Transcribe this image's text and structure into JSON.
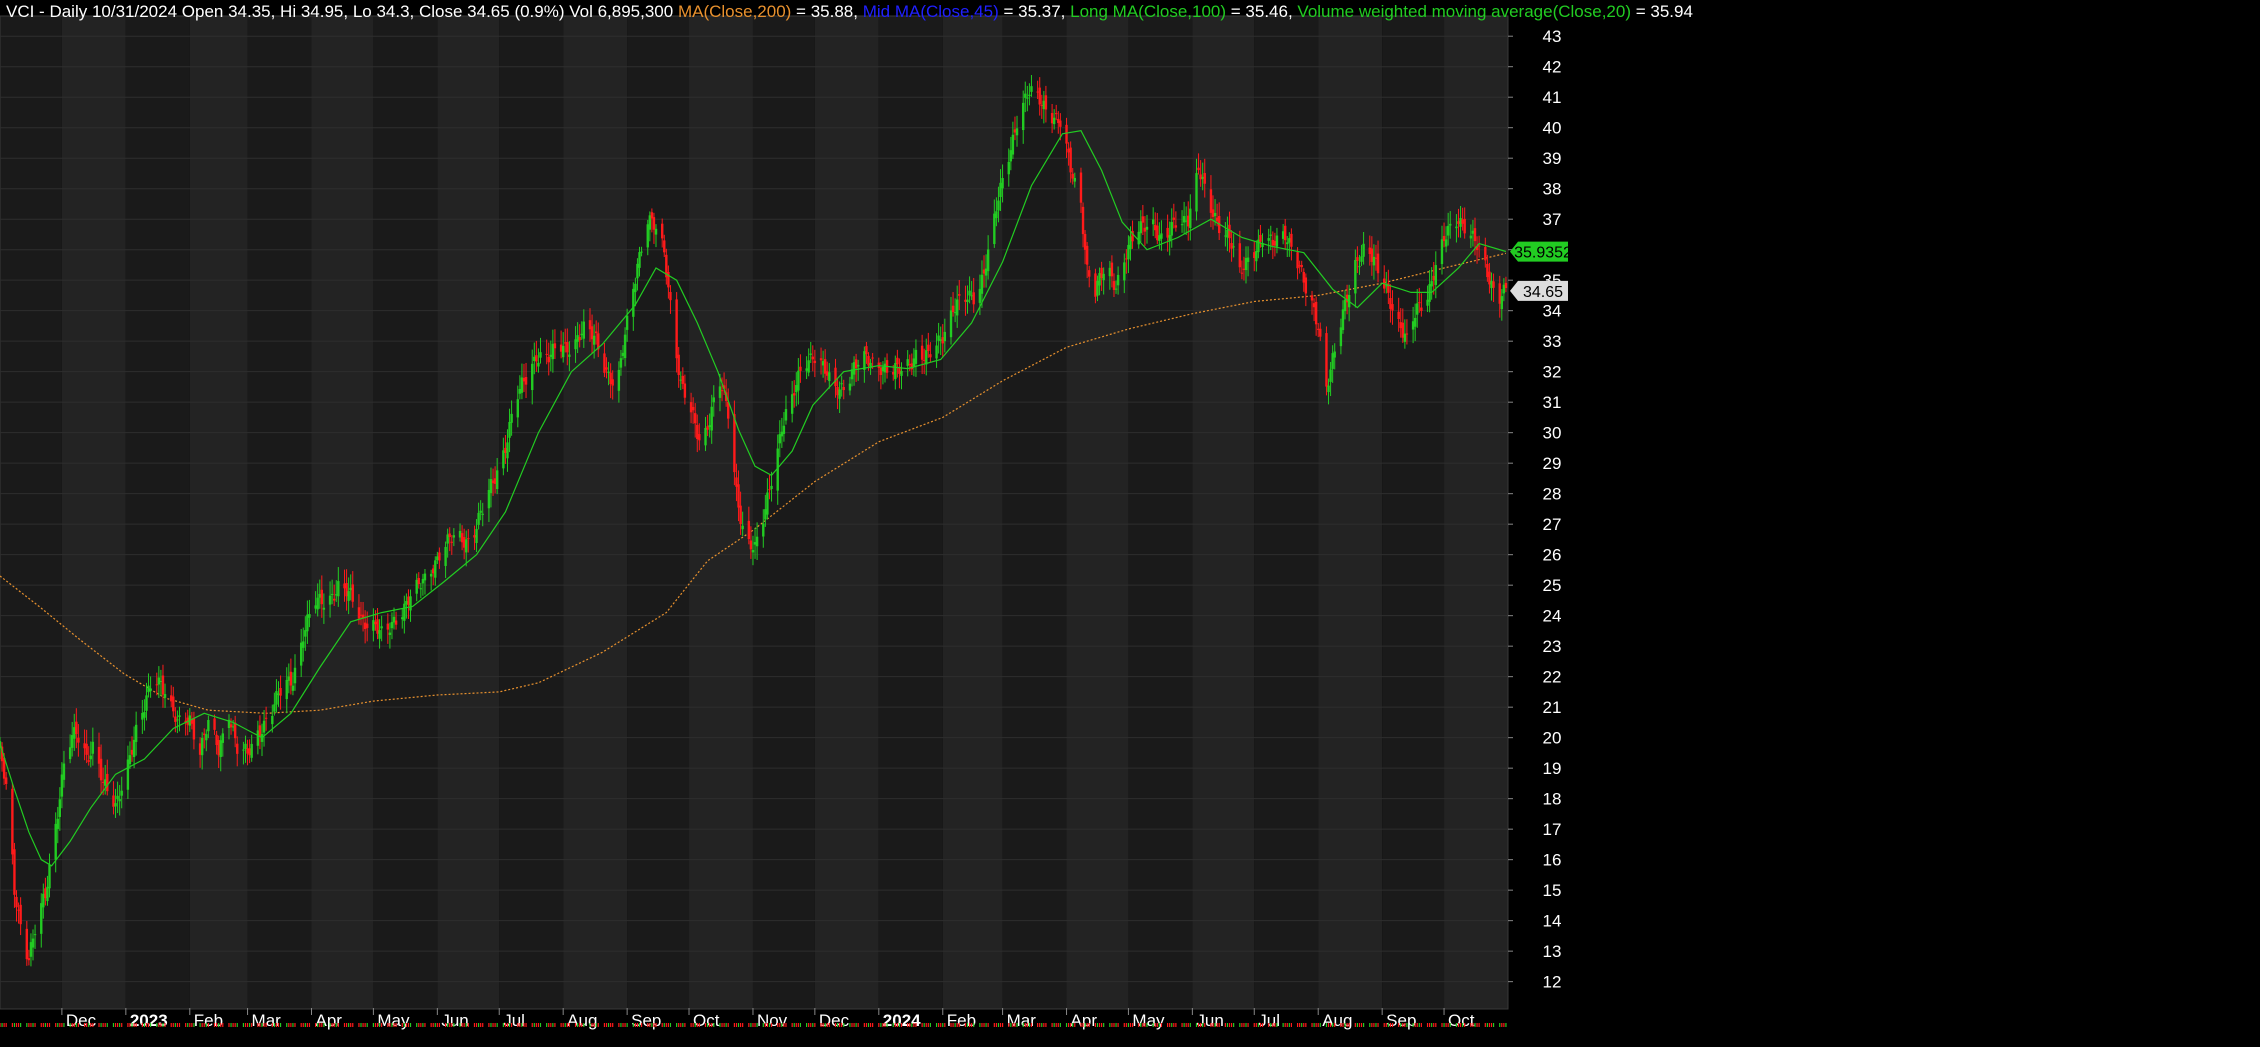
{
  "header": {
    "quote": "VCI - Daily 10/31/2024 Open 34.35, Hi 34.95, Lo 34.3, Close 34.65 (0.9%) Vol 6,895,300 ",
    "ma200_label": "MA(Close,200)",
    "ma200_value": " = 35.88, ",
    "mid_ma_label": "Mid MA(Close,45)",
    "mid_ma_value": " = 35.37, ",
    "long_ma_label": "Long MA(Close,100)",
    "long_ma_value": " = 35.46, ",
    "vwma_label": "Volume weighted moving average(Close,20)",
    "vwma_value": " = 35.94"
  },
  "colors": {
    "background": "#000000",
    "plot_band_a": "#1a1a1a",
    "plot_band_b": "#232323",
    "grid": "#2e2e2e",
    "up_candle": "#22cc22",
    "down_candle": "#ff1a1a",
    "vwma_line": "#22cc22",
    "ma200_line": "#e8912e",
    "mid_ma_label": "#2020ff",
    "axis_text": "#ffffff",
    "vwma_badge": "#22cc22",
    "price_badge": "#dddddd"
  },
  "chart_data": {
    "type": "candlestick",
    "symbol": "VCI",
    "y_axis": {
      "min": 11.3,
      "max": 43.4,
      "ticks": [
        12,
        13,
        14,
        15,
        16,
        17,
        18,
        19,
        20,
        21,
        22,
        23,
        24,
        25,
        26,
        27,
        28,
        29,
        30,
        31,
        32,
        33,
        34,
        35,
        36,
        37,
        38,
        39,
        40,
        41,
        42,
        43
      ]
    },
    "x_axis": {
      "start": "2022-11-01",
      "end": "2024-10-31",
      "right_margin_days": 1,
      "month_labels": [
        {
          "date": "2022-12-01",
          "label": "Dec",
          "bold": false
        },
        {
          "date": "2023-01-01",
          "label": "2023",
          "bold": true
        },
        {
          "date": "2023-02-01",
          "label": "Feb",
          "bold": false
        },
        {
          "date": "2023-03-01",
          "label": "Mar",
          "bold": false
        },
        {
          "date": "2023-04-01",
          "label": "Apr",
          "bold": false
        },
        {
          "date": "2023-05-01",
          "label": "May",
          "bold": false
        },
        {
          "date": "2023-06-01",
          "label": "Jun",
          "bold": false
        },
        {
          "date": "2023-07-01",
          "label": "Jul",
          "bold": false
        },
        {
          "date": "2023-08-01",
          "label": "Aug",
          "bold": false
        },
        {
          "date": "2023-09-01",
          "label": "Sep",
          "bold": false
        },
        {
          "date": "2023-10-01",
          "label": "Oct",
          "bold": false
        },
        {
          "date": "2023-11-01",
          "label": "Nov",
          "bold": false
        },
        {
          "date": "2023-12-01",
          "label": "Dec",
          "bold": false
        },
        {
          "date": "2024-01-01",
          "label": "2024",
          "bold": true
        },
        {
          "date": "2024-02-01",
          "label": "Feb",
          "bold": false
        },
        {
          "date": "2024-03-01",
          "label": "Mar",
          "bold": false
        },
        {
          "date": "2024-04-01",
          "label": "Apr",
          "bold": false
        },
        {
          "date": "2024-05-01",
          "label": "May",
          "bold": false
        },
        {
          "date": "2024-06-01",
          "label": "Jun",
          "bold": false
        },
        {
          "date": "2024-07-01",
          "label": "Jul",
          "bold": false
        },
        {
          "date": "2024-08-01",
          "label": "Aug",
          "bold": false
        },
        {
          "date": "2024-09-01",
          "label": "Sep",
          "bold": false
        },
        {
          "date": "2024-10-01",
          "label": "Oct",
          "bold": false
        }
      ]
    },
    "close_path": [
      [
        "2022-11-01",
        19.6
      ],
      [
        "2022-11-05",
        17.8
      ],
      [
        "2022-11-08",
        15.0
      ],
      [
        "2022-11-12",
        13.6
      ],
      [
        "2022-11-15",
        12.8
      ],
      [
        "2022-11-19",
        13.9
      ],
      [
        "2022-11-23",
        14.8
      ],
      [
        "2022-11-28",
        17.2
      ],
      [
        "2022-12-03",
        19.6
      ],
      [
        "2022-12-08",
        20.1
      ],
      [
        "2022-12-13",
        19.4
      ],
      [
        "2022-12-17",
        19.9
      ],
      [
        "2022-12-21",
        18.4
      ],
      [
        "2022-12-27",
        17.7
      ],
      [
        "2022-12-31",
        18.8
      ],
      [
        "2023-01-05",
        19.9
      ],
      [
        "2023-01-10",
        20.9
      ],
      [
        "2023-01-14",
        22.1
      ],
      [
        "2023-01-18",
        21.9
      ],
      [
        "2023-01-22",
        21.1
      ],
      [
        "2023-01-26",
        20.4
      ],
      [
        "2023-02-01",
        20.7
      ],
      [
        "2023-02-06",
        19.6
      ],
      [
        "2023-02-10",
        20.4
      ],
      [
        "2023-02-15",
        19.6
      ],
      [
        "2023-02-20",
        20.9
      ],
      [
        "2023-02-24",
        19.6
      ],
      [
        "2023-03-01",
        19.4
      ],
      [
        "2023-03-07",
        20.3
      ],
      [
        "2023-03-13",
        20.9
      ],
      [
        "2023-03-18",
        21.6
      ],
      [
        "2023-03-23",
        22.0
      ],
      [
        "2023-03-28",
        23.4
      ],
      [
        "2023-04-03",
        24.4
      ],
      [
        "2023-04-09",
        24.6
      ],
      [
        "2023-04-14",
        24.9
      ],
      [
        "2023-04-20",
        24.6
      ],
      [
        "2023-04-26",
        23.9
      ],
      [
        "2023-05-01",
        23.7
      ],
      [
        "2023-05-06",
        23.2
      ],
      [
        "2023-05-11",
        23.9
      ],
      [
        "2023-05-17",
        24.4
      ],
      [
        "2023-05-23",
        24.9
      ],
      [
        "2023-05-29",
        25.6
      ],
      [
        "2023-06-04",
        26.2
      ],
      [
        "2023-06-10",
        26.6
      ],
      [
        "2023-06-17",
        26.5
      ],
      [
        "2023-06-23",
        27.4
      ],
      [
        "2023-06-29",
        28.6
      ],
      [
        "2023-07-04",
        29.6
      ],
      [
        "2023-07-09",
        31.0
      ],
      [
        "2023-07-14",
        31.8
      ],
      [
        "2023-07-19",
        32.6
      ],
      [
        "2023-07-25",
        32.4
      ],
      [
        "2023-07-30",
        32.8
      ],
      [
        "2023-08-05",
        32.9
      ],
      [
        "2023-08-11",
        33.3
      ],
      [
        "2023-08-17",
        33.1
      ],
      [
        "2023-08-22",
        32.1
      ],
      [
        "2023-08-27",
        31.3
      ],
      [
        "2023-09-01",
        33.6
      ],
      [
        "2023-09-06",
        35.6
      ],
      [
        "2023-09-11",
        37.0
      ],
      [
        "2023-09-15",
        36.6
      ],
      [
        "2023-09-19",
        35.9
      ],
      [
        "2023-09-22",
        34.3
      ],
      [
        "2023-09-27",
        31.6
      ],
      [
        "2023-10-02",
        30.6
      ],
      [
        "2023-10-07",
        29.6
      ],
      [
        "2023-10-12",
        30.8
      ],
      [
        "2023-10-16",
        31.6
      ],
      [
        "2023-10-20",
        30.6
      ],
      [
        "2023-10-24",
        28.1
      ],
      [
        "2023-10-28",
        26.6
      ],
      [
        "2023-11-02",
        26.1
      ],
      [
        "2023-11-06",
        27.1
      ],
      [
        "2023-11-10",
        28.6
      ],
      [
        "2023-11-15",
        30.2
      ],
      [
        "2023-11-20",
        31.0
      ],
      [
        "2023-11-25",
        32.3
      ],
      [
        "2023-11-30",
        32.6
      ],
      [
        "2023-12-05",
        32.1
      ],
      [
        "2023-12-10",
        31.4
      ],
      [
        "2023-12-15",
        31.6
      ],
      [
        "2023-12-20",
        32.1
      ],
      [
        "2023-12-26",
        32.4
      ],
      [
        "2024-01-01",
        32.3
      ],
      [
        "2024-01-07",
        31.9
      ],
      [
        "2024-01-13",
        32.1
      ],
      [
        "2024-01-19",
        32.6
      ],
      [
        "2024-01-25",
        32.4
      ],
      [
        "2024-01-31",
        33.1
      ],
      [
        "2024-02-06",
        34.1
      ],
      [
        "2024-02-12",
        34.3
      ],
      [
        "2024-02-18",
        34.6
      ],
      [
        "2024-02-23",
        35.9
      ],
      [
        "2024-02-28",
        37.6
      ],
      [
        "2024-03-04",
        39.1
      ],
      [
        "2024-03-09",
        40.6
      ],
      [
        "2024-03-14",
        41.1
      ],
      [
        "2024-03-19",
        40.9
      ],
      [
        "2024-03-24",
        40.6
      ],
      [
        "2024-03-29",
        40.1
      ],
      [
        "2024-04-03",
        38.6
      ],
      [
        "2024-04-08",
        37.6
      ],
      [
        "2024-04-11",
        35.4
      ],
      [
        "2024-04-15",
        34.6
      ],
      [
        "2024-04-20",
        35.4
      ],
      [
        "2024-04-25",
        34.9
      ],
      [
        "2024-04-30",
        35.9
      ],
      [
        "2024-05-06",
        36.6
      ],
      [
        "2024-05-12",
        37.1
      ],
      [
        "2024-05-18",
        36.1
      ],
      [
        "2024-05-24",
        36.9
      ],
      [
        "2024-05-30",
        37.1
      ],
      [
        "2024-06-04",
        38.6
      ],
      [
        "2024-06-09",
        37.4
      ],
      [
        "2024-06-14",
        36.9
      ],
      [
        "2024-06-19",
        36.4
      ],
      [
        "2024-06-24",
        35.1
      ],
      [
        "2024-06-29",
        35.9
      ],
      [
        "2024-07-05",
        36.4
      ],
      [
        "2024-07-10",
        36.1
      ],
      [
        "2024-07-16",
        36.6
      ],
      [
        "2024-07-21",
        35.9
      ],
      [
        "2024-07-26",
        34.6
      ],
      [
        "2024-08-01",
        33.6
      ],
      [
        "2024-08-05",
        31.6
      ],
      [
        "2024-08-09",
        32.6
      ],
      [
        "2024-08-14",
        34.1
      ],
      [
        "2024-08-19",
        35.6
      ],
      [
        "2024-08-24",
        36.1
      ],
      [
        "2024-08-29",
        35.4
      ],
      [
        "2024-09-04",
        34.6
      ],
      [
        "2024-09-09",
        33.6
      ],
      [
        "2024-09-13",
        32.9
      ],
      [
        "2024-09-18",
        34.1
      ],
      [
        "2024-09-23",
        34.6
      ],
      [
        "2024-09-28",
        35.6
      ],
      [
        "2024-10-03",
        36.6
      ],
      [
        "2024-10-08",
        37.1
      ],
      [
        "2024-10-13",
        36.6
      ],
      [
        "2024-10-18",
        35.9
      ],
      [
        "2024-10-23",
        35.1
      ],
      [
        "2024-10-27",
        34.5
      ],
      [
        "2024-10-31",
        34.65
      ]
    ],
    "vwma20": [
      [
        "2022-11-01",
        19.8
      ],
      [
        "2022-11-08",
        18.3
      ],
      [
        "2022-11-15",
        16.9
      ],
      [
        "2022-11-21",
        16.0
      ],
      [
        "2022-11-26",
        15.8
      ],
      [
        "2022-12-05",
        16.6
      ],
      [
        "2022-12-15",
        17.7
      ],
      [
        "2022-12-27",
        18.8
      ],
      [
        "2023-01-10",
        19.3
      ],
      [
        "2023-01-24",
        20.3
      ],
      [
        "2023-02-08",
        20.8
      ],
      [
        "2023-02-22",
        20.5
      ],
      [
        "2023-03-08",
        20.0
      ],
      [
        "2023-03-22",
        20.8
      ],
      [
        "2023-04-05",
        22.3
      ],
      [
        "2023-04-20",
        23.8
      ],
      [
        "2023-05-05",
        24.1
      ],
      [
        "2023-05-20",
        24.3
      ],
      [
        "2023-06-04",
        25.1
      ],
      [
        "2023-06-20",
        26.0
      ],
      [
        "2023-07-04",
        27.4
      ],
      [
        "2023-07-20",
        30.0
      ],
      [
        "2023-08-05",
        32.0
      ],
      [
        "2023-08-20",
        32.9
      ],
      [
        "2023-09-05",
        34.2
      ],
      [
        "2023-09-15",
        35.4
      ],
      [
        "2023-09-25",
        35.0
      ],
      [
        "2023-10-05",
        33.6
      ],
      [
        "2023-10-15",
        32.0
      ],
      [
        "2023-10-25",
        30.1
      ],
      [
        "2023-11-02",
        28.9
      ],
      [
        "2023-11-10",
        28.6
      ],
      [
        "2023-11-20",
        29.4
      ],
      [
        "2023-11-30",
        30.9
      ],
      [
        "2023-12-15",
        32.0
      ],
      [
        "2024-01-01",
        32.2
      ],
      [
        "2024-01-15",
        32.1
      ],
      [
        "2024-01-31",
        32.4
      ],
      [
        "2024-02-15",
        33.6
      ],
      [
        "2024-03-01",
        35.6
      ],
      [
        "2024-03-15",
        38.1
      ],
      [
        "2024-03-30",
        39.8
      ],
      [
        "2024-04-08",
        39.9
      ],
      [
        "2024-04-18",
        38.6
      ],
      [
        "2024-04-28",
        36.9
      ],
      [
        "2024-05-10",
        36.0
      ],
      [
        "2024-05-25",
        36.4
      ],
      [
        "2024-06-10",
        37.0
      ],
      [
        "2024-06-25",
        36.4
      ],
      [
        "2024-07-10",
        36.1
      ],
      [
        "2024-07-25",
        35.9
      ],
      [
        "2024-08-08",
        34.7
      ],
      [
        "2024-08-20",
        34.1
      ],
      [
        "2024-09-01",
        34.9
      ],
      [
        "2024-09-15",
        34.6
      ],
      [
        "2024-09-25",
        34.6
      ],
      [
        "2024-10-08",
        35.4
      ],
      [
        "2024-10-18",
        36.2
      ],
      [
        "2024-10-31",
        35.94
      ]
    ],
    "ma200": [
      [
        "2022-11-01",
        25.3
      ],
      [
        "2022-11-20",
        24.3
      ],
      [
        "2022-12-10",
        23.2
      ],
      [
        "2022-12-31",
        22.1
      ],
      [
        "2023-01-20",
        21.3
      ],
      [
        "2023-02-10",
        20.9
      ],
      [
        "2023-03-10",
        20.8
      ],
      [
        "2023-04-05",
        20.9
      ],
      [
        "2023-05-01",
        21.2
      ],
      [
        "2023-06-01",
        21.4
      ],
      [
        "2023-07-01",
        21.5
      ],
      [
        "2023-07-20",
        21.8
      ],
      [
        "2023-08-20",
        22.8
      ],
      [
        "2023-09-20",
        24.1
      ],
      [
        "2023-10-10",
        25.8
      ],
      [
        "2023-11-01",
        26.8
      ],
      [
        "2023-12-01",
        28.4
      ],
      [
        "2024-01-01",
        29.7
      ],
      [
        "2024-02-01",
        30.5
      ],
      [
        "2024-03-01",
        31.7
      ],
      [
        "2024-04-01",
        32.8
      ],
      [
        "2024-05-01",
        33.4
      ],
      [
        "2024-06-01",
        33.9
      ],
      [
        "2024-07-01",
        34.3
      ],
      [
        "2024-08-01",
        34.5
      ],
      [
        "2024-09-01",
        34.9
      ],
      [
        "2024-10-01",
        35.4
      ],
      [
        "2024-10-31",
        35.88
      ]
    ],
    "last_values": {
      "vwma20": "35.9352",
      "close": "34.65"
    }
  }
}
